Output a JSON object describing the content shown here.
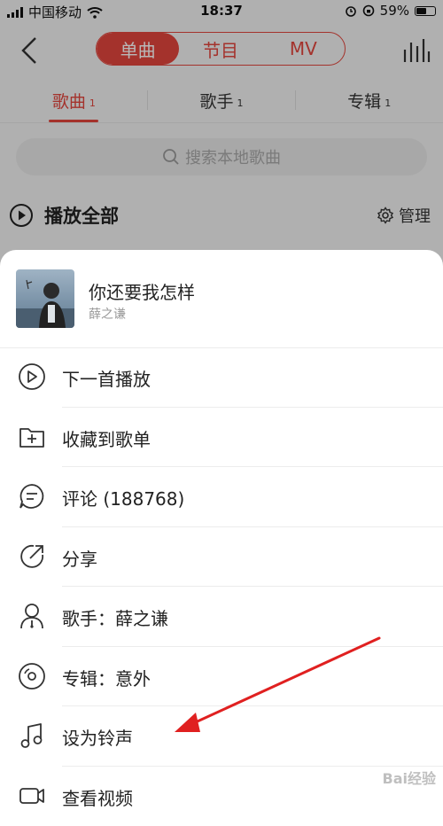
{
  "status_bar": {
    "carrier": "中国移动",
    "time": "18:37",
    "battery": "59%",
    "battery_level": 0.59
  },
  "header": {
    "segments": [
      "单曲",
      "节目",
      "MV"
    ],
    "active_segment": 0
  },
  "tabs": [
    {
      "label": "歌曲",
      "count": "1"
    },
    {
      "label": "歌手",
      "count": "1"
    },
    {
      "label": "专辑",
      "count": "1"
    }
  ],
  "search": {
    "placeholder": "搜索本地歌曲"
  },
  "play_all": {
    "label": "播放全部",
    "manage": "管理"
  },
  "sheet": {
    "song": {
      "title": "你还要我怎样",
      "artist": "薛之谦"
    },
    "menu": [
      {
        "label": "下一首播放",
        "icon": "play-next-icon"
      },
      {
        "label": "收藏到歌单",
        "icon": "add-folder-icon"
      },
      {
        "label": "评论 (188768)",
        "icon": "comment-icon"
      },
      {
        "label": "分享",
        "icon": "share-icon"
      },
      {
        "label": "歌手：薛之谦",
        "icon": "singer-icon"
      },
      {
        "label": "专辑：意外",
        "icon": "album-icon"
      },
      {
        "label": "设为铃声",
        "icon": "ringtone-icon"
      },
      {
        "label": "查看视频",
        "icon": "video-icon"
      }
    ]
  },
  "watermark": "Bai经验",
  "colors": {
    "accent": "#e4463d",
    "annotation_arrow": "#e02020"
  }
}
